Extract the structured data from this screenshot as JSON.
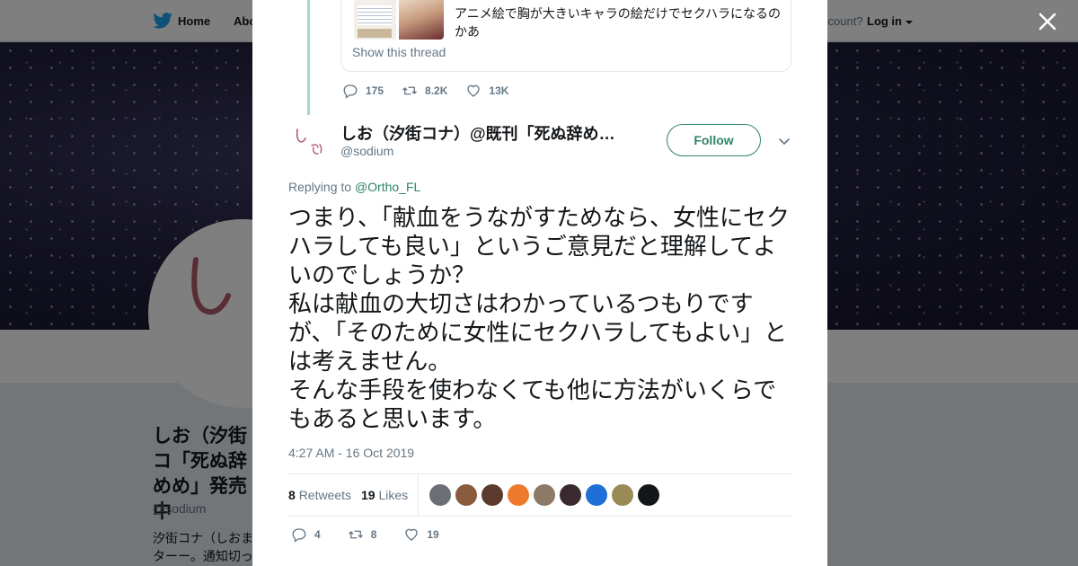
{
  "topbar": {
    "home_label": "Home",
    "about_label": "Abo",
    "account_label": "ccount?",
    "login_label": "Log in"
  },
  "profile": {
    "name": "しお（汐街コ「死ぬ辞めめ」発売中",
    "handle": "@sodium",
    "bio": "汐街コナ（しおまターー。通知切って"
  },
  "quoted": {
    "text": "アニメ絵で胸が大きいキャラの絵だけでセクハラになるのかあ",
    "show_thread_label": "Show this thread",
    "replies": "175",
    "retweets": "8.2K",
    "likes": "13K"
  },
  "tweet": {
    "author_name": "しお（汐街コナ）@既刊「死ぬ辞める」「ブラック企業…",
    "author_handle": "@sodium",
    "follow_label": "Follow",
    "replying_prefix": "Replying to",
    "replying_to": "@Ortho_FL",
    "text": "つまり、「献血をうながすためなら、女性にセクハラしても良い」というご意見だと理解してよいのでしょうか？\n私は献血の大切さはわかっているつもりですが、「そのために女性にセクハラしてもよい」とは考えません。\nそんな手段を使わなくても他に方法がいくらでもあると思います。",
    "timestamp": "4:27 AM - 16 Oct 2019",
    "retweets_count": "8",
    "retweets_label": "Retweets",
    "likes_count": "19",
    "likes_label": "Likes",
    "likers": [
      {
        "name": "liker-1",
        "color": "#6b6e72"
      },
      {
        "name": "liker-2",
        "color": "#8a5a3c"
      },
      {
        "name": "liker-3",
        "color": "#5c3a2e"
      },
      {
        "name": "liker-4",
        "color": "#f07a2b"
      },
      {
        "name": "liker-5",
        "color": "#8c7a66"
      },
      {
        "name": "liker-6",
        "color": "#3a2a2f"
      },
      {
        "name": "liker-7",
        "color": "#1f6fd6"
      },
      {
        "name": "liker-8",
        "color": "#9a8a55"
      },
      {
        "name": "liker-9",
        "color": "#14171a"
      }
    ],
    "replies": "4",
    "retweets": "8",
    "likes": "19"
  },
  "colors": {
    "accent": "#2e8566",
    "text": "#14171a",
    "muted": "#657786",
    "thread_line": "#a3d9c6"
  }
}
